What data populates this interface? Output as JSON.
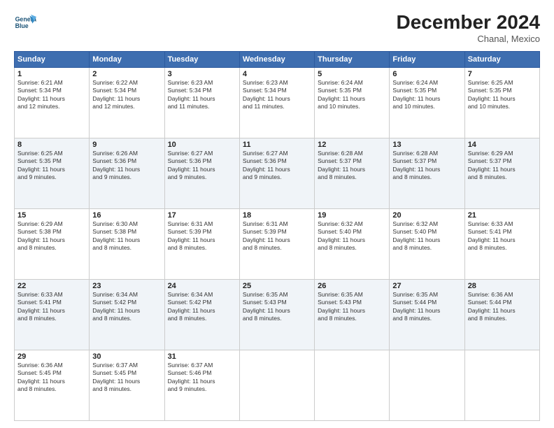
{
  "header": {
    "logo_line1": "General",
    "logo_line2": "Blue",
    "month": "December 2024",
    "location": "Chanal, Mexico"
  },
  "days_of_week": [
    "Sunday",
    "Monday",
    "Tuesday",
    "Wednesday",
    "Thursday",
    "Friday",
    "Saturday"
  ],
  "weeks": [
    [
      {
        "day": "1",
        "info": "Sunrise: 6:21 AM\nSunset: 5:34 PM\nDaylight: 11 hours\nand 12 minutes."
      },
      {
        "day": "2",
        "info": "Sunrise: 6:22 AM\nSunset: 5:34 PM\nDaylight: 11 hours\nand 12 minutes."
      },
      {
        "day": "3",
        "info": "Sunrise: 6:23 AM\nSunset: 5:34 PM\nDaylight: 11 hours\nand 11 minutes."
      },
      {
        "day": "4",
        "info": "Sunrise: 6:23 AM\nSunset: 5:34 PM\nDaylight: 11 hours\nand 11 minutes."
      },
      {
        "day": "5",
        "info": "Sunrise: 6:24 AM\nSunset: 5:35 PM\nDaylight: 11 hours\nand 10 minutes."
      },
      {
        "day": "6",
        "info": "Sunrise: 6:24 AM\nSunset: 5:35 PM\nDaylight: 11 hours\nand 10 minutes."
      },
      {
        "day": "7",
        "info": "Sunrise: 6:25 AM\nSunset: 5:35 PM\nDaylight: 11 hours\nand 10 minutes."
      }
    ],
    [
      {
        "day": "8",
        "info": "Sunrise: 6:25 AM\nSunset: 5:35 PM\nDaylight: 11 hours\nand 9 minutes."
      },
      {
        "day": "9",
        "info": "Sunrise: 6:26 AM\nSunset: 5:36 PM\nDaylight: 11 hours\nand 9 minutes."
      },
      {
        "day": "10",
        "info": "Sunrise: 6:27 AM\nSunset: 5:36 PM\nDaylight: 11 hours\nand 9 minutes."
      },
      {
        "day": "11",
        "info": "Sunrise: 6:27 AM\nSunset: 5:36 PM\nDaylight: 11 hours\nand 9 minutes."
      },
      {
        "day": "12",
        "info": "Sunrise: 6:28 AM\nSunset: 5:37 PM\nDaylight: 11 hours\nand 8 minutes."
      },
      {
        "day": "13",
        "info": "Sunrise: 6:28 AM\nSunset: 5:37 PM\nDaylight: 11 hours\nand 8 minutes."
      },
      {
        "day": "14",
        "info": "Sunrise: 6:29 AM\nSunset: 5:37 PM\nDaylight: 11 hours\nand 8 minutes."
      }
    ],
    [
      {
        "day": "15",
        "info": "Sunrise: 6:29 AM\nSunset: 5:38 PM\nDaylight: 11 hours\nand 8 minutes."
      },
      {
        "day": "16",
        "info": "Sunrise: 6:30 AM\nSunset: 5:38 PM\nDaylight: 11 hours\nand 8 minutes."
      },
      {
        "day": "17",
        "info": "Sunrise: 6:31 AM\nSunset: 5:39 PM\nDaylight: 11 hours\nand 8 minutes."
      },
      {
        "day": "18",
        "info": "Sunrise: 6:31 AM\nSunset: 5:39 PM\nDaylight: 11 hours\nand 8 minutes."
      },
      {
        "day": "19",
        "info": "Sunrise: 6:32 AM\nSunset: 5:40 PM\nDaylight: 11 hours\nand 8 minutes."
      },
      {
        "day": "20",
        "info": "Sunrise: 6:32 AM\nSunset: 5:40 PM\nDaylight: 11 hours\nand 8 minutes."
      },
      {
        "day": "21",
        "info": "Sunrise: 6:33 AM\nSunset: 5:41 PM\nDaylight: 11 hours\nand 8 minutes."
      }
    ],
    [
      {
        "day": "22",
        "info": "Sunrise: 6:33 AM\nSunset: 5:41 PM\nDaylight: 11 hours\nand 8 minutes."
      },
      {
        "day": "23",
        "info": "Sunrise: 6:34 AM\nSunset: 5:42 PM\nDaylight: 11 hours\nand 8 minutes."
      },
      {
        "day": "24",
        "info": "Sunrise: 6:34 AM\nSunset: 5:42 PM\nDaylight: 11 hours\nand 8 minutes."
      },
      {
        "day": "25",
        "info": "Sunrise: 6:35 AM\nSunset: 5:43 PM\nDaylight: 11 hours\nand 8 minutes."
      },
      {
        "day": "26",
        "info": "Sunrise: 6:35 AM\nSunset: 5:43 PM\nDaylight: 11 hours\nand 8 minutes."
      },
      {
        "day": "27",
        "info": "Sunrise: 6:35 AM\nSunset: 5:44 PM\nDaylight: 11 hours\nand 8 minutes."
      },
      {
        "day": "28",
        "info": "Sunrise: 6:36 AM\nSunset: 5:44 PM\nDaylight: 11 hours\nand 8 minutes."
      }
    ],
    [
      {
        "day": "29",
        "info": "Sunrise: 6:36 AM\nSunset: 5:45 PM\nDaylight: 11 hours\nand 8 minutes."
      },
      {
        "day": "30",
        "info": "Sunrise: 6:37 AM\nSunset: 5:45 PM\nDaylight: 11 hours\nand 8 minutes."
      },
      {
        "day": "31",
        "info": "Sunrise: 6:37 AM\nSunset: 5:46 PM\nDaylight: 11 hours\nand 9 minutes."
      },
      {
        "day": "",
        "info": ""
      },
      {
        "day": "",
        "info": ""
      },
      {
        "day": "",
        "info": ""
      },
      {
        "day": "",
        "info": ""
      }
    ]
  ]
}
